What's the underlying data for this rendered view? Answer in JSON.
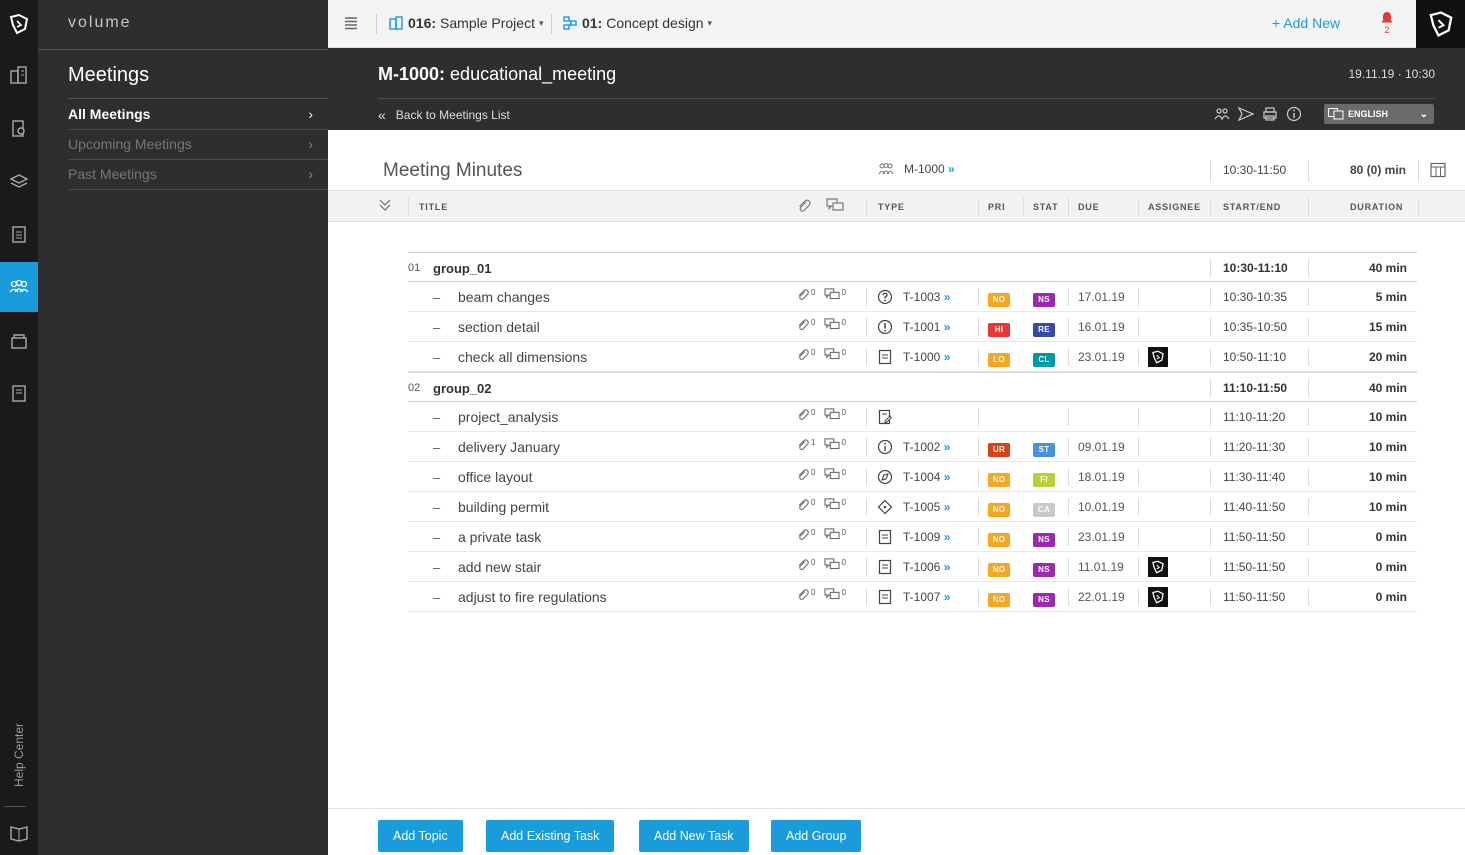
{
  "app": {
    "brand": "volume",
    "help_center": "Help Center"
  },
  "nav": {
    "title": "Meetings",
    "items": [
      {
        "label": "All Meetings",
        "active": true
      },
      {
        "label": "Upcoming Meetings",
        "active": false
      },
      {
        "label": "Past Meetings",
        "active": false
      }
    ]
  },
  "topbar": {
    "project_code": "016:",
    "project_name": "Sample Project",
    "phase_code": "01:",
    "phase_name": "Concept design",
    "add_new": "+ Add New",
    "notifications": "2"
  },
  "meeting": {
    "code": "M-1000:",
    "name": "educational_meeting",
    "datetime": "19.11.19 · 10:30",
    "back_label": "Back to Meetings List",
    "language": "ENGLISH"
  },
  "minutes": {
    "title": "Meeting Minutes",
    "meeting_ref": "M-1000",
    "time_range": "10:30-11:50",
    "total_duration": "80 (0) min"
  },
  "columns": {
    "title": "TITLE",
    "type": "TYPE",
    "pri": "PRI",
    "stat": "STAT",
    "due": "DUE",
    "assignee": "ASSIGNEE",
    "start_end": "START/END",
    "duration": "DURATION"
  },
  "colors": {
    "accent": "#1a9bdb",
    "NO": "#f5a623",
    "HI": "#e53935",
    "LO": "#f5a623",
    "UR": "#d84315",
    "NS": "#9c27b0",
    "RE": "#3949ab",
    "CL": "#0097a7",
    "ST": "#4a90e2",
    "FI": "#b5d334",
    "CA": "#c8c8c8"
  },
  "rows": [
    {
      "kind": "group",
      "num": "01",
      "title": "group_01",
      "start_end": "10:30-11:10",
      "duration": "40 min"
    },
    {
      "kind": "topic",
      "title": "beam changes",
      "links": "0",
      "comments": "0",
      "type_icon": "question-icon",
      "task_id": "T-1003",
      "pri": "NO",
      "stat": "NS",
      "due": "17.01.19",
      "assignee": false,
      "start_end": "10:30-10:35",
      "duration": "5 min"
    },
    {
      "kind": "topic",
      "title": "section detail",
      "links": "0",
      "comments": "0",
      "type_icon": "exclamation-icon",
      "task_id": "T-1001",
      "pri": "HI",
      "stat": "RE",
      "due": "16.01.19",
      "assignee": false,
      "start_end": "10:35-10:50",
      "duration": "15 min"
    },
    {
      "kind": "topic",
      "title": "check all dimensions",
      "links": "0",
      "comments": "0",
      "type_icon": "note-icon",
      "task_id": "T-1000",
      "pri": "LO",
      "stat": "CL",
      "due": "23.01.19",
      "assignee": true,
      "start_end": "10:50-11:10",
      "duration": "20 min"
    },
    {
      "kind": "group",
      "num": "02",
      "title": "group_02",
      "start_end": "11:10-11:50",
      "duration": "40 min"
    },
    {
      "kind": "topic",
      "title": "project_analysis",
      "links": "0",
      "comments": "0",
      "type_icon": "document-edit-icon",
      "task_id": "",
      "pri": "",
      "stat": "",
      "due": "",
      "assignee": false,
      "start_end": "11:10-11:20",
      "duration": "10 min"
    },
    {
      "kind": "topic",
      "title": "delivery January",
      "links": "1",
      "comments": "0",
      "type_icon": "info-icon",
      "task_id": "T-1002",
      "pri": "UR",
      "stat": "ST",
      "due": "09.01.19",
      "assignee": false,
      "start_end": "11:20-11:30",
      "duration": "10 min"
    },
    {
      "kind": "topic",
      "title": "office layout",
      "links": "0",
      "comments": "0",
      "type_icon": "compass-icon",
      "task_id": "T-1004",
      "pri": "NO",
      "stat": "FI",
      "due": "18.01.19",
      "assignee": false,
      "start_end": "11:30-11:40",
      "duration": "10 min"
    },
    {
      "kind": "topic",
      "title": "building permit",
      "links": "0",
      "comments": "0",
      "type_icon": "diamond-icon",
      "task_id": "T-1005",
      "pri": "NO",
      "stat": "CA",
      "due": "10.01.19",
      "assignee": false,
      "start_end": "11:40-11:50",
      "duration": "10 min"
    },
    {
      "kind": "topic",
      "title": "a private task",
      "links": "0",
      "comments": "0",
      "type_icon": "note-icon",
      "task_id": "T-1009",
      "pri": "NO",
      "stat": "NS",
      "due": "23.01.19",
      "assignee": false,
      "start_end": "11:50-11:50",
      "duration": "0 min"
    },
    {
      "kind": "topic",
      "title": "add new stair",
      "links": "0",
      "comments": "0",
      "type_icon": "note-icon",
      "task_id": "T-1006",
      "pri": "NO",
      "stat": "NS",
      "due": "11.01.19",
      "assignee": true,
      "start_end": "11:50-11:50",
      "duration": "0 min"
    },
    {
      "kind": "topic",
      "title": "adjust to fire regulations",
      "links": "0",
      "comments": "0",
      "type_icon": "note-icon",
      "task_id": "T-1007",
      "pri": "NO",
      "stat": "NS",
      "due": "22.01.19",
      "assignee": true,
      "start_end": "11:50-11:50",
      "duration": "0 min"
    }
  ],
  "footer": {
    "add_topic": "Add Topic",
    "add_existing_task": "Add Existing Task",
    "add_new_task": "Add New Task",
    "add_group": "Add Group"
  }
}
